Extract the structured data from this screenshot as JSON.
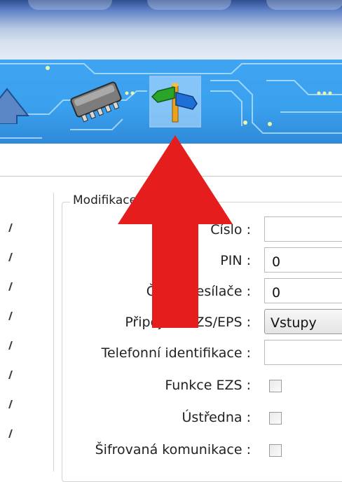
{
  "form": {
    "group_title": "Modifikace",
    "rows": [
      {
        "label": "Číslo :",
        "type": "text",
        "value": ""
      },
      {
        "label": "PIN :",
        "type": "text",
        "value": "0"
      },
      {
        "label": "Číslo přesílače :",
        "type": "text",
        "value": "0"
      },
      {
        "label": "Připojení EZS/EPS :",
        "type": "select",
        "value": "Vstupy"
      },
      {
        "label": "Telefonní identifikace :",
        "type": "text",
        "value": ""
      },
      {
        "label": "Funkce EZS :",
        "type": "checkbox",
        "checked": false
      },
      {
        "label": "Ústředna :",
        "type": "checkbox",
        "checked": false
      },
      {
        "label": "Šifrovaná komunikace :",
        "type": "checkbox",
        "checked": false
      }
    ]
  },
  "toolbar": {
    "buttons": [
      {
        "icon": "up-arrow-icon"
      },
      {
        "icon": "chip-icon"
      },
      {
        "icon": "signpost-icon",
        "selected": true
      }
    ]
  },
  "colors": {
    "toolbar_bg": "#3aa1ef",
    "annotation_arrow": "#e51d1d"
  }
}
